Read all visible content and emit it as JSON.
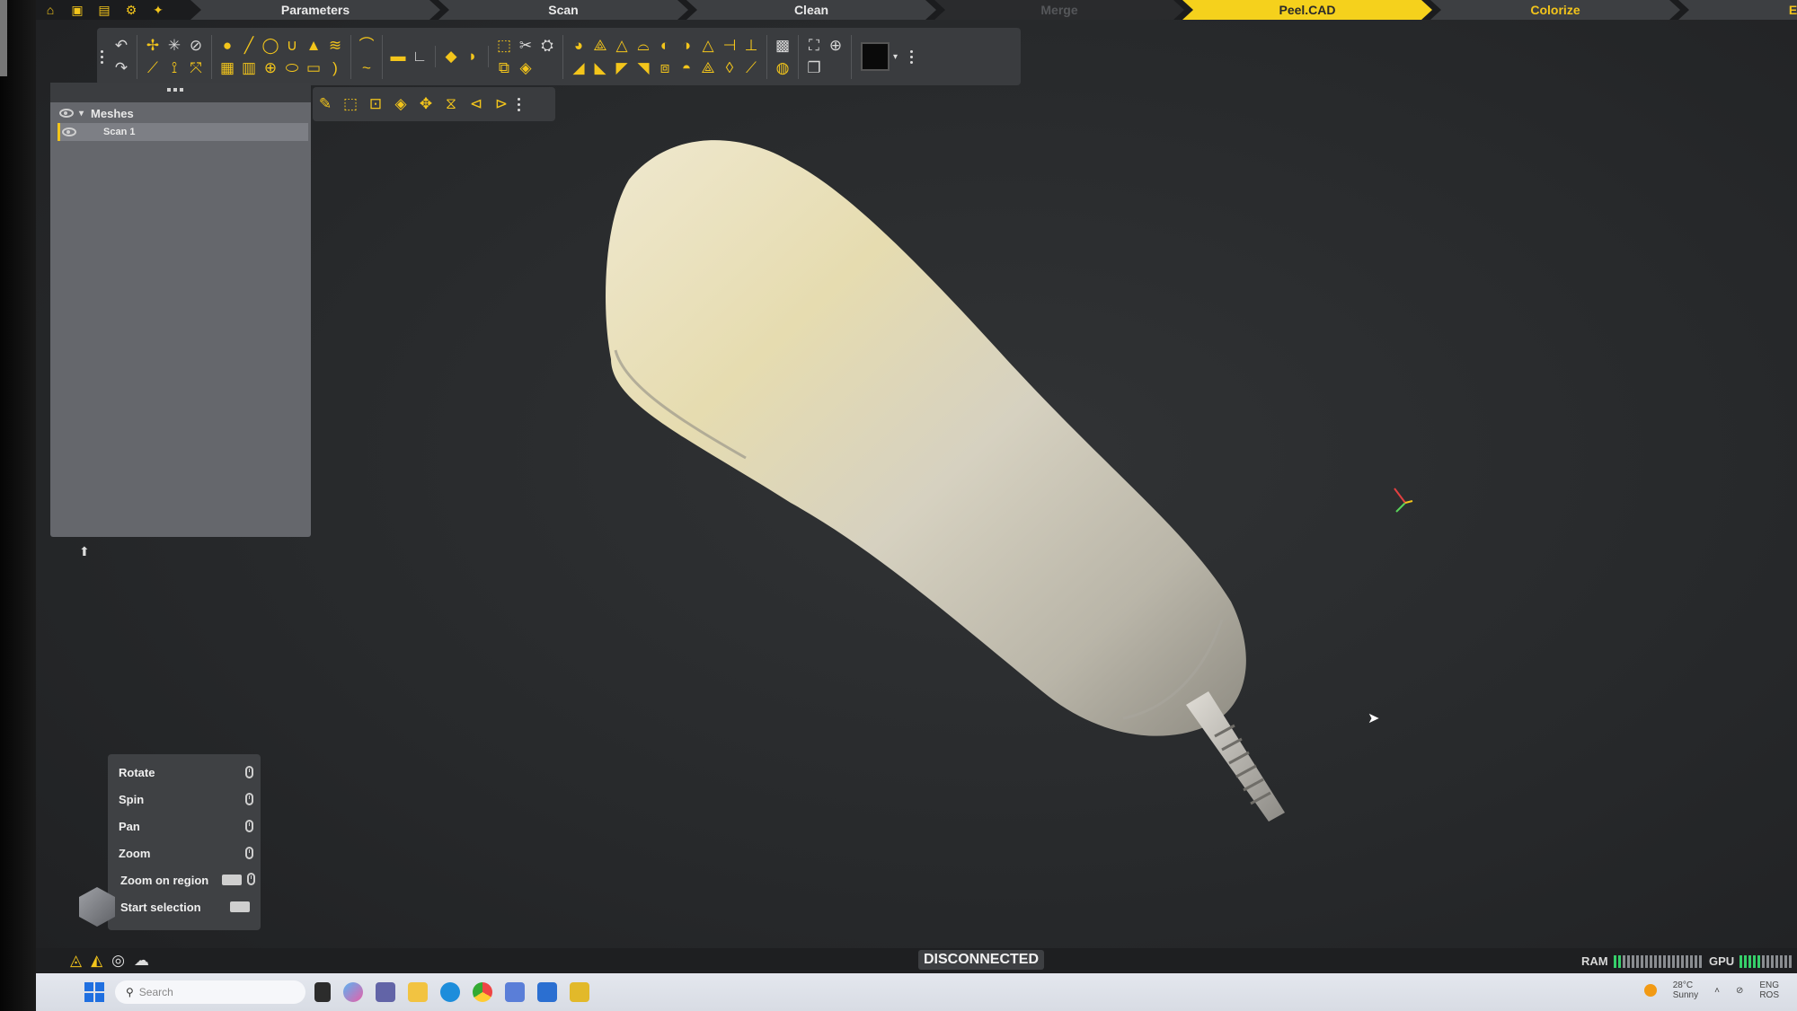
{
  "steps": [
    {
      "label": "Parameters",
      "state": "normal"
    },
    {
      "label": "Scan",
      "state": "normal"
    },
    {
      "label": "Clean",
      "state": "normal"
    },
    {
      "label": "Merge",
      "state": "disabled"
    },
    {
      "label": "Peel.CAD",
      "state": "active"
    },
    {
      "label": "Colorize",
      "state": "highlight"
    },
    {
      "label": "Ex",
      "state": "highlight"
    }
  ],
  "scene_tree": {
    "group_label": "Meshes",
    "items": [
      {
        "label": "Scan 1",
        "selected": true
      }
    ]
  },
  "viewer": {
    "object_icon": "3d-scan-mesh-icon",
    "axis_icon": "axis-gizmo-icon"
  },
  "help": {
    "items": [
      {
        "label": "Rotate"
      },
      {
        "label": "Spin"
      },
      {
        "label": "Pan"
      },
      {
        "label": "Zoom"
      },
      {
        "label": "Zoom on region"
      },
      {
        "label": "Start selection"
      }
    ]
  },
  "status": {
    "connection": "DISCONNECTED",
    "ram_label": "RAM",
    "gpu_label": "GPU"
  },
  "taskbar": {
    "search_placeholder": "Search",
    "weather_temp": "28°C",
    "weather_desc": "Sunny",
    "lang": "ENG",
    "region": "ROS"
  },
  "colors": {
    "accent": "#f5d11c",
    "panel": "#65676c",
    "background": "#2a2c2e"
  }
}
